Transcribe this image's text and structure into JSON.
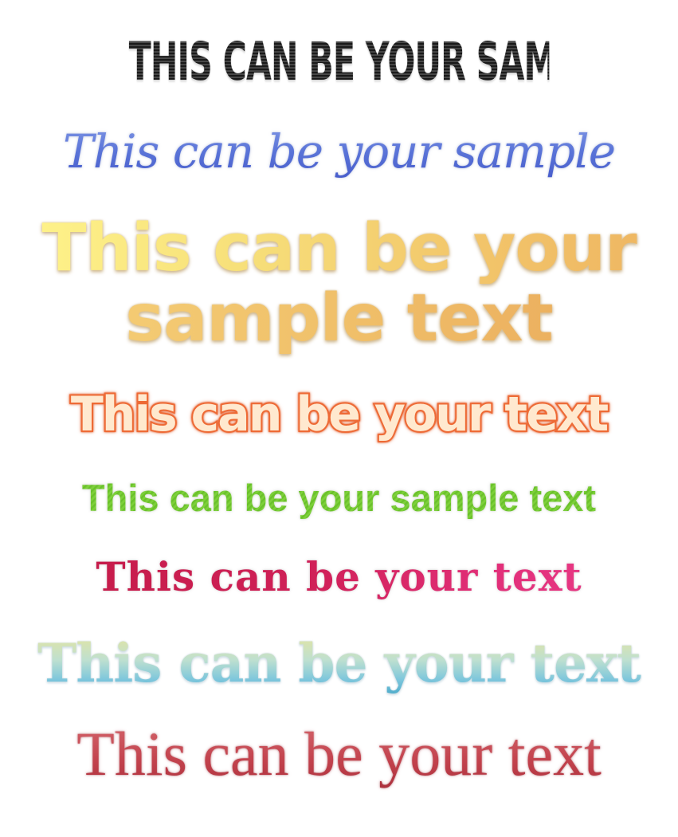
{
  "samples": [
    {
      "text": "THIS CAN BE YOUR SAMPLE"
    },
    {
      "text": "This can be your sample"
    },
    {
      "lines": [
        "This can be your",
        "sample text"
      ]
    },
    {
      "text": "This can be your text"
    },
    {
      "text": "This can be your sample text"
    },
    {
      "text": "This can be your text"
    },
    {
      "text": "This can be your text"
    },
    {
      "text": "This can be your text"
    }
  ],
  "colors": {
    "s1": "#1a1a1a",
    "s2": "#4f66d0",
    "s3": "#f2c56a",
    "s4": "#ee6a35",
    "s5": "#72c832",
    "s6": "#cf2057",
    "s7": "#47a8c8",
    "s8": "#c2414c"
  }
}
